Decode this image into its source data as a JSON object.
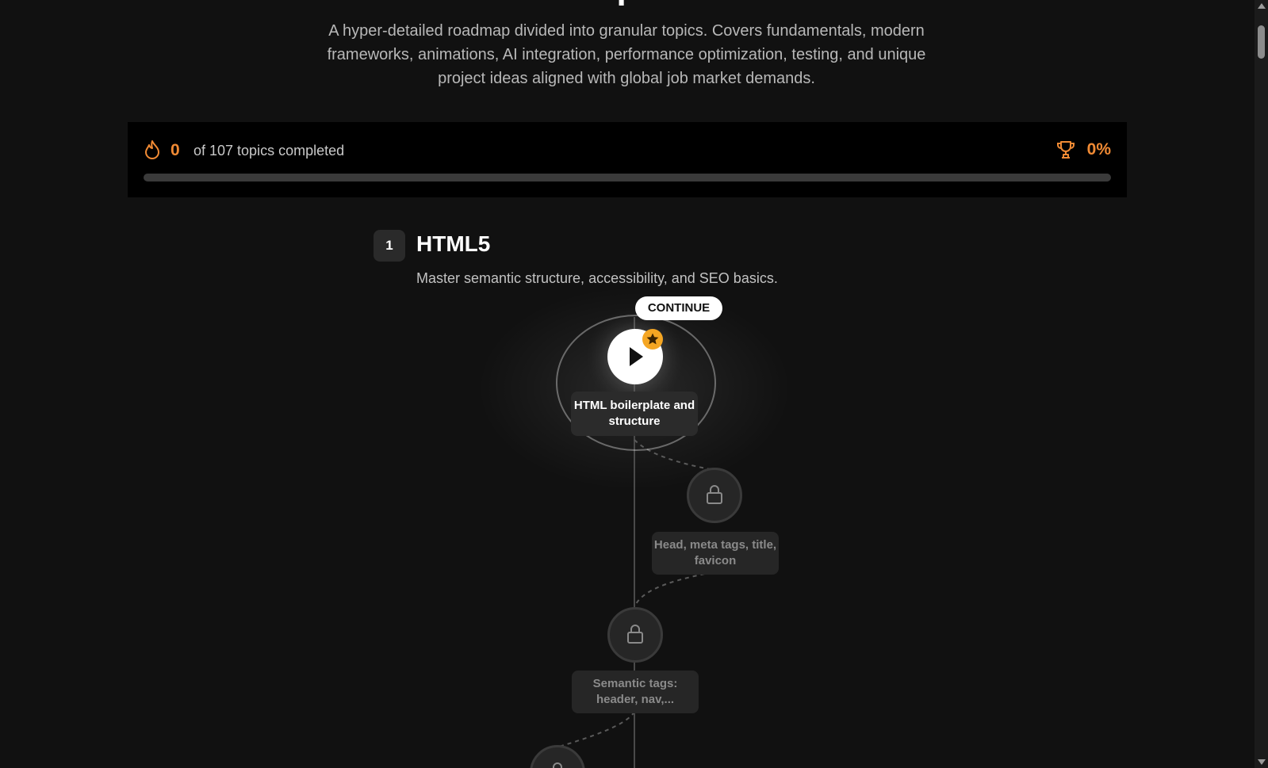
{
  "header": {
    "title_partial": "p",
    "subtitle": "A hyper-detailed roadmap divided into granular topics. Covers fundamentals, modern frameworks, animations, AI integration, performance optimization, testing, and unique project ideas aligned with global job market demands."
  },
  "progress": {
    "completed_count": "0",
    "completed_text": "of 107 topics completed",
    "percent_label": "0%",
    "fill_fraction": 0,
    "accent_color": "#f08a34",
    "flame_icon": "flame-icon",
    "trophy_icon": "trophy-icon"
  },
  "section": {
    "number": "1",
    "title": "HTML5",
    "description": "Master semantic structure, accessibility, and SEO basics."
  },
  "roadmap": {
    "continue_label": "CONTINUE",
    "nodes": [
      {
        "label": "HTML boilerplate and structure",
        "state": "active",
        "icon": "play-icon"
      },
      {
        "label": "Head, meta tags, title, favicon",
        "state": "locked",
        "icon": "lock-icon"
      },
      {
        "label": "Semantic tags: header, nav,...",
        "state": "locked",
        "icon": "lock-icon"
      },
      {
        "label": "",
        "state": "locked",
        "icon": "lock-icon"
      }
    ],
    "badge_color": "#f5a623"
  }
}
